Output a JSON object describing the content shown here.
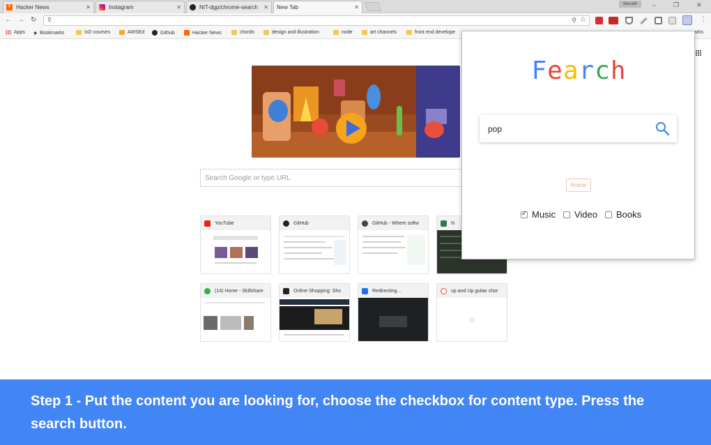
{
  "tabs": [
    {
      "label": "Hacker News",
      "favicon": "y-icon"
    },
    {
      "label": "Instagram",
      "favicon": "instagram-icon"
    },
    {
      "label": "NIT-dgp/chrome-search",
      "favicon": "github-icon"
    },
    {
      "label": "New Tab",
      "favicon": "none"
    }
  ],
  "profile_label": "thecafé",
  "bookmarks": [
    {
      "label": "Apps",
      "icon": "apps-grid-icon"
    },
    {
      "label": "Bookmarks",
      "icon": "star-icon"
    },
    {
      "label": "IxD courses",
      "icon": "folder-icon"
    },
    {
      "label": "AWSEd",
      "icon": "folder-icon"
    },
    {
      "label": "Github",
      "icon": "github-icon"
    },
    {
      "label": "Hacker News",
      "icon": "y-icon"
    },
    {
      "label": "chords",
      "icon": "folder-icon"
    },
    {
      "label": "design and illustration",
      "icon": "folder-icon"
    },
    {
      "label": "node",
      "icon": "folder-icon"
    },
    {
      "label": "art channels",
      "icon": "folder-icon"
    },
    {
      "label": "front end develope",
      "icon": "folder-icon"
    },
    {
      "label": "marks",
      "icon": "none"
    }
  ],
  "google_search_placeholder": "Search Google or type URL",
  "tiles": [
    {
      "title": "YouTube",
      "icon_color": "#e62117"
    },
    {
      "title": "GitHub",
      "icon_color": "#222222"
    },
    {
      "title": "GitHub - Where softw",
      "icon_color": "#444444"
    },
    {
      "title": "N",
      "icon_color": "#2a7a4a"
    },
    {
      "title": "(14) Home - Skillshare",
      "icon_color": "#2bb24c"
    },
    {
      "title": "Online Shopping: Sho",
      "icon_color": "#222222"
    },
    {
      "title": "Redirecting...",
      "icon_color": "#1a73e8"
    },
    {
      "title": "up and Up guitar chor",
      "icon_color": "#ea4335"
    }
  ],
  "popup": {
    "brand_letters": [
      {
        "ch": "F",
        "color": "#4285f4"
      },
      {
        "ch": "e",
        "color": "#ea4335"
      },
      {
        "ch": "a",
        "color": "#fbbc05"
      },
      {
        "ch": "r",
        "color": "#4285f4"
      },
      {
        "ch": "c",
        "color": "#34a853"
      },
      {
        "ch": "h",
        "color": "#ea4335"
      }
    ],
    "search_value": "pop",
    "chip_label": "Anime",
    "options": [
      {
        "label": "Music",
        "checked": true
      },
      {
        "label": "Video",
        "checked": false
      },
      {
        "label": "Books",
        "checked": false
      }
    ]
  },
  "banner_text": "Step 1 - Put the content you are looking for, choose the checkbox for content type. Press the search button.",
  "colors": {
    "banner": "#4285f4",
    "accent_blue": "#4285f4"
  }
}
